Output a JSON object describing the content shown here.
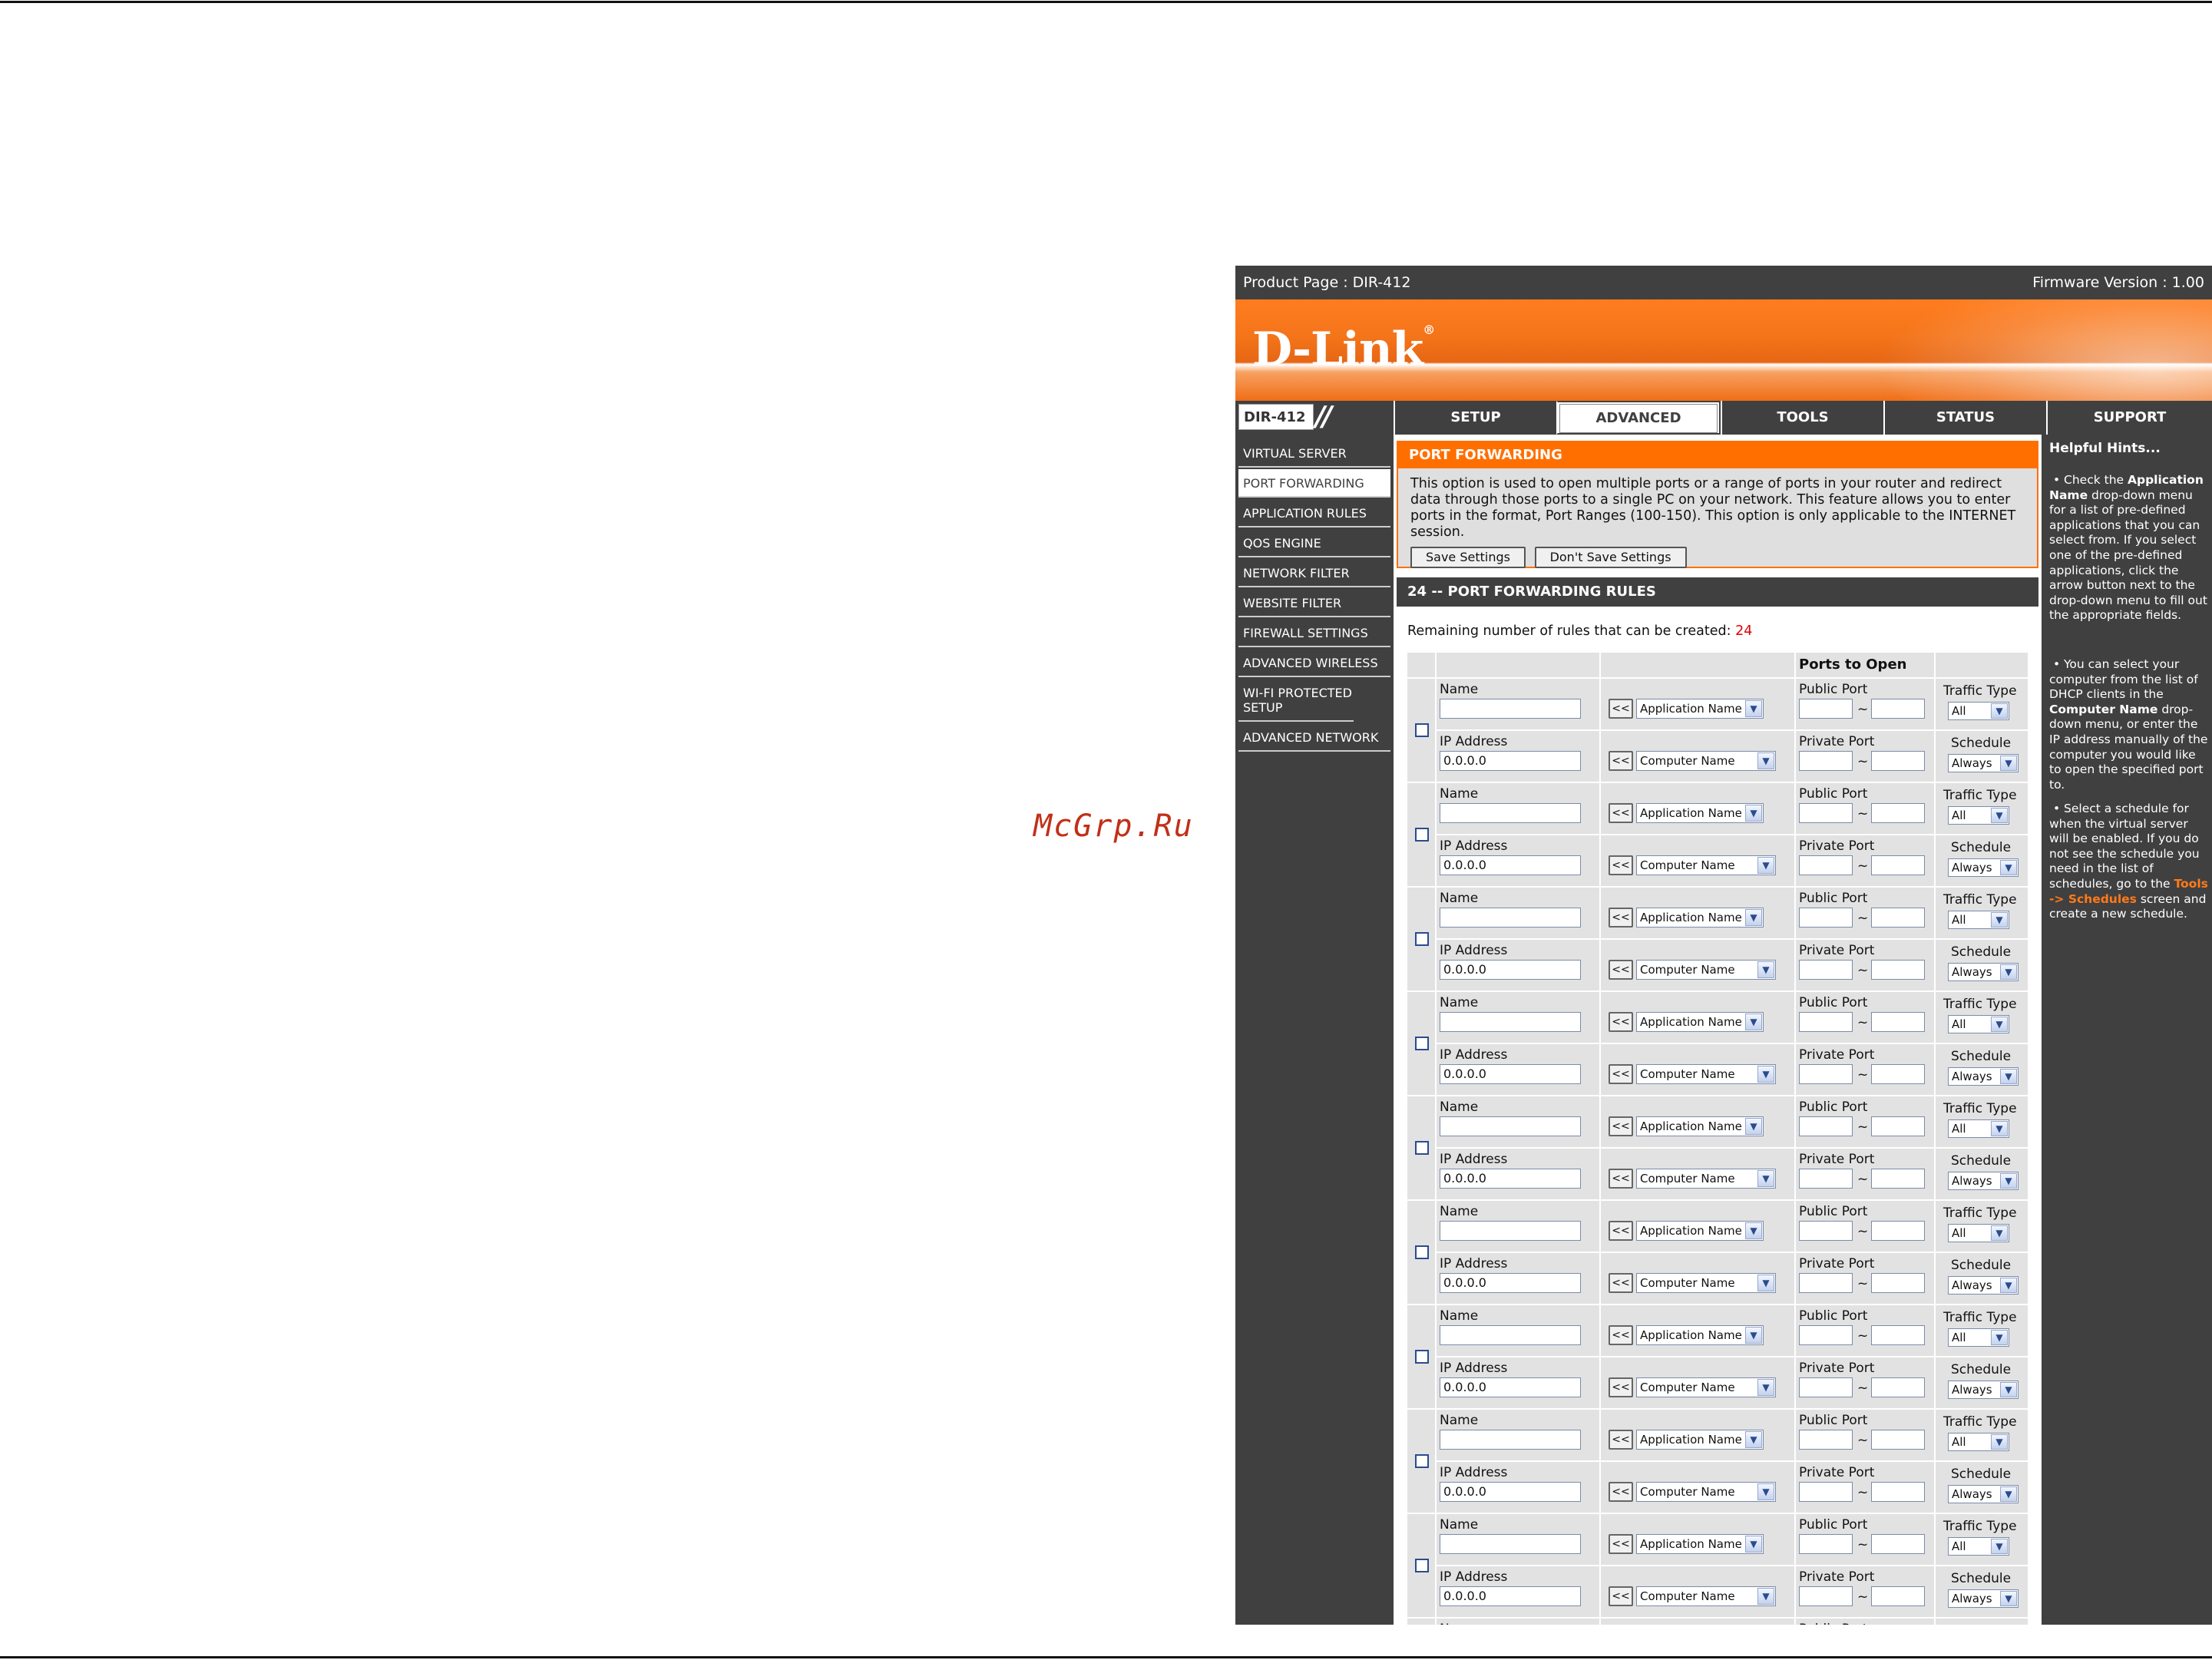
{
  "watermark": "McGrp.Ru",
  "topbar": {
    "product": "Product Page : DIR-412",
    "firmware": "Firmware Version : 1.00"
  },
  "brand": {
    "logo": "D-Link",
    "mark": "®",
    "model": "DIR-412",
    "slashes": "//"
  },
  "tabs": [
    {
      "label": "SETUP"
    },
    {
      "label": "ADVANCED"
    },
    {
      "label": "TOOLS"
    },
    {
      "label": "STATUS"
    },
    {
      "label": "SUPPORT"
    }
  ],
  "sidebar": {
    "items": [
      {
        "label": "VIRTUAL SERVER"
      },
      {
        "label": "PORT FORWARDING"
      },
      {
        "label": "APPLICATION RULES"
      },
      {
        "label": "QOS ENGINE"
      },
      {
        "label": "NETWORK FILTER"
      },
      {
        "label": "WEBSITE FILTER"
      },
      {
        "label": "FIREWALL SETTINGS"
      },
      {
        "label": "ADVANCED WIRELESS"
      },
      {
        "label": "WI-FI PROTECTED SETUP"
      },
      {
        "label": "ADVANCED NETWORK"
      }
    ]
  },
  "port_forwarding": {
    "title": "PORT FORWARDING",
    "description": "This option is used to open multiple ports or a range of ports in your router and redirect data through those ports to a single PC on your network. This feature allows you to enter ports in the format, Port Ranges (100-150). This option is only applicable to the INTERNET session.",
    "save_label": "Save Settings",
    "dont_save_label": "Don't Save Settings"
  },
  "rules": {
    "title": "24 -- PORT FORWARDING RULES",
    "remaining_label": "Remaining number of rules that can be created:",
    "remaining_count": "24",
    "ports_header": "Ports to Open",
    "name_label": "Name",
    "ip_label": "IP Address",
    "ip_value": "0.0.0.0",
    "arrow_label": "<<",
    "app_select": "Application Name",
    "computer_select": "Computer Name",
    "public_port_label": "Public Port",
    "private_port_label": "Private Port",
    "tilde": "~",
    "traffic_label": "Traffic Type",
    "traffic_value": "All",
    "schedule_label": "Schedule",
    "schedule_value": "Always"
  },
  "hints": {
    "title": "Helpful Hints...",
    "h1_a": "• Check the",
    "h1_b": "Application Name",
    "h1_c": "drop-down menu for a list of pre-defined applications that you can select from. If you select one of the pre-defined applications, click the arrow button next to the drop-down menu to fill out the appropriate fields.",
    "h2_a": "• You can select your computer from the list of DHCP clients in the",
    "h2_b": "Computer Name",
    "h2_c": "drop-down menu, or enter the IP address manually of the computer you would like to open the specified port to.",
    "h3_a": "• Select a schedule for when the virtual server will be enabled. If you do not see the schedule you need in the list of schedules, go to the",
    "h3_b": "Tools -> Schedules",
    "h3_c": "screen and create a new schedule."
  }
}
